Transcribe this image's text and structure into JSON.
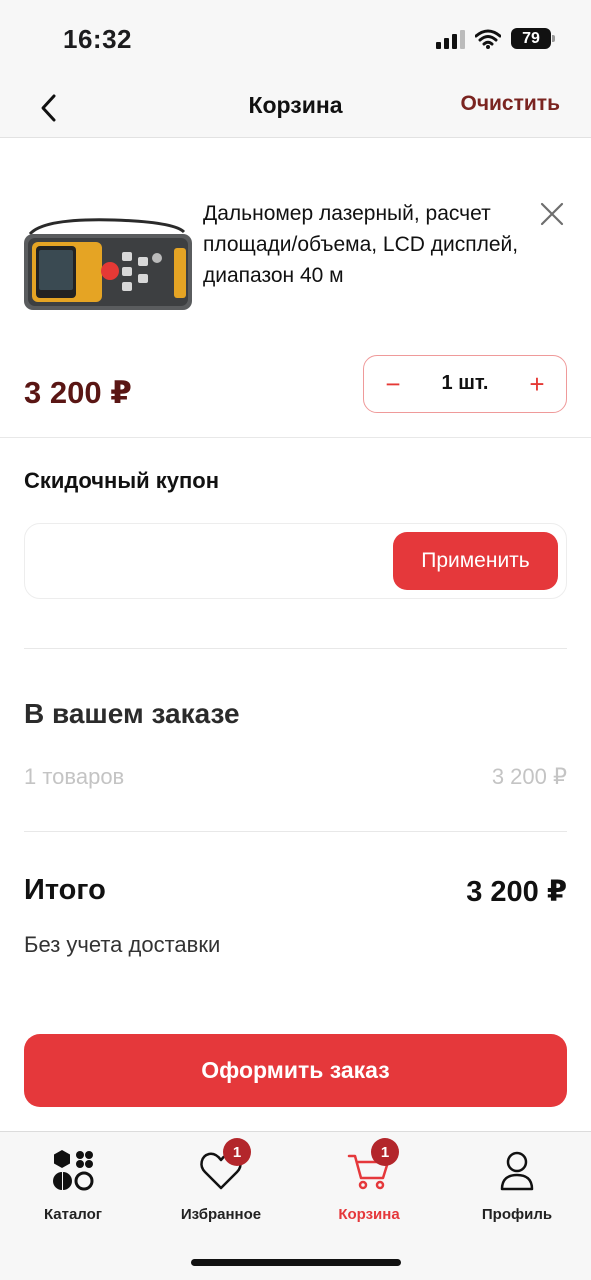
{
  "status_bar": {
    "time": "16:32",
    "battery": "79"
  },
  "header": {
    "title": "Корзина",
    "clear_label": "Очистить"
  },
  "cart": {
    "items": [
      {
        "name": "Дальномер лазерный, расчет площади/объема, LCD дисплей, диапазон 40 м",
        "price": "3 200 ₽",
        "quantity": "1 шт.",
        "minus_label": "−",
        "plus_label": "+"
      }
    ]
  },
  "coupon": {
    "title": "Скидочный купон",
    "placeholder": "",
    "value": "",
    "apply_label": "Применить"
  },
  "summary": {
    "title": "В вашем заказе",
    "items_count": "1 товаров",
    "items_sum": "3 200 ₽",
    "total_label": "Итого",
    "total_value": "3 200 ₽",
    "delivery_note": "Без учета доставки"
  },
  "checkout": {
    "label": "Оформить заказ"
  },
  "tab_bar": {
    "tabs": [
      {
        "label": "Каталог",
        "icon": "catalog-icon",
        "active": false
      },
      {
        "label": "Избранное",
        "icon": "heart-icon",
        "badge": "1",
        "active": false
      },
      {
        "label": "Корзина",
        "icon": "cart-icon",
        "badge": "1",
        "active": true
      },
      {
        "label": "Профиль",
        "icon": "profile-icon",
        "active": false
      }
    ]
  },
  "colors": {
    "accent": "#e5383b",
    "price": "#5a1614",
    "clear": "#7a2420",
    "badge": "#b3262b"
  }
}
